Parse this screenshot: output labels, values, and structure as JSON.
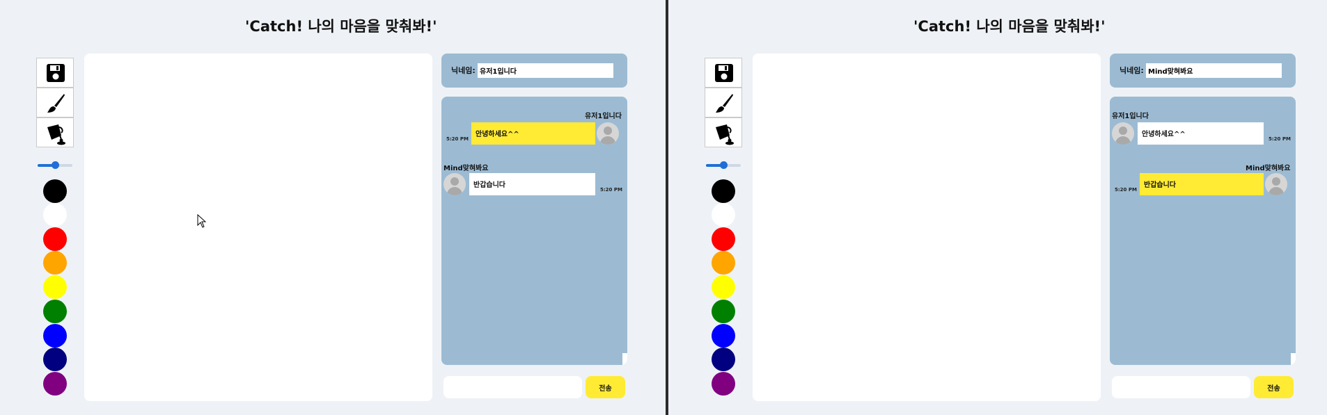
{
  "left": {
    "title": "'Catch! 나의 마음을 맞춰봐!'",
    "nickname_label": "닉네임:",
    "nickname_value": "유저1입니다",
    "chat": {
      "msg1": {
        "sender": "유저1입니다",
        "text": "안녕하세요^^",
        "time": "5:20 PM"
      },
      "msg2": {
        "sender": "Mind맞혀봐요",
        "text": "반갑습니다",
        "time": "5:20 PM"
      }
    },
    "send_label": "전송"
  },
  "right": {
    "title": "'Catch! 나의 마음을 맞춰봐!'",
    "nickname_label": "닉네임:",
    "nickname_value": "Mind맞혀봐요",
    "chat": {
      "msg1": {
        "sender": "유저1입니다",
        "text": "안녕하세요^^",
        "time": "5:20 PM"
      },
      "msg2": {
        "sender": "Mind맞혀봐요",
        "text": "반갑습니다",
        "time": "5:20 PM"
      }
    },
    "send_label": "전송"
  },
  "tools": [
    "save-icon",
    "brush-icon",
    "paint-bucket-icon"
  ],
  "brush_size": 0.5,
  "colors": [
    "#000000",
    "#ffffff",
    "#ff0000",
    "#ffa500",
    "#ffff00",
    "#008000",
    "#0000ff",
    "#000080",
    "#800080"
  ],
  "accent": {
    "bubble_mine": "#ffeb33",
    "panel": "#9cbbd3"
  }
}
